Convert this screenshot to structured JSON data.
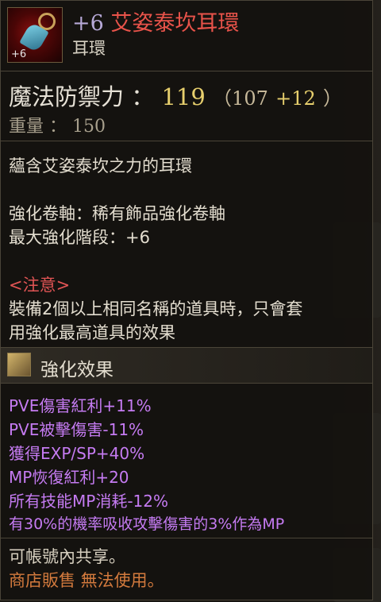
{
  "item": {
    "enhance_level_badge": "+6",
    "enhance_prefix": "+6",
    "name": "艾姿泰坎耳環",
    "type": "耳環"
  },
  "stats": {
    "main_label": "魔法防禦力",
    "colon": "：",
    "main_value": "119",
    "base_open": "（107",
    "bonus": "+12",
    "base_close": "）",
    "weight_label": "重量",
    "weight_colon": "：",
    "weight_value": "150"
  },
  "description": "蘊含艾姿泰坎之力的耳環",
  "enhance_info": {
    "scroll_line": "強化卷軸：稀有飾品強化卷軸",
    "max_line": "最大強化階段：+6"
  },
  "notice": {
    "header": "<注意>",
    "line1": "裝備2個以上相同名稱的道具時，只會套",
    "line2": "用強化最高道具的效果"
  },
  "effects": {
    "header": "強化效果",
    "items": [
      "PVE傷害紅利+11%",
      "PVE被擊傷害-11%",
      "獲得EXP/SP+40%",
      "MP恢復紅利+20",
      "所有技能MP消耗-12%",
      "有30%的機率吸收攻擊傷害的3%作為MP"
    ]
  },
  "footer": {
    "share": "可帳號內共享。",
    "shop": "商店販售 無法使用。"
  },
  "colors": {
    "title": "#e8534a",
    "stat_value": "#e7cf6d",
    "effect": "#c57bf2",
    "notice": "#e05454",
    "shop": "#d37a3d"
  }
}
